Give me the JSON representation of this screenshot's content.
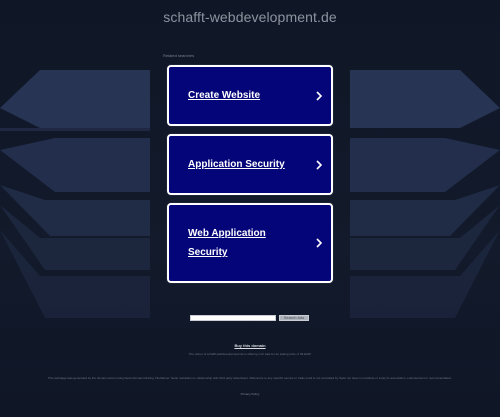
{
  "header": {
    "domain_title": "schafft-webdevelopment.de",
    "related_searches_label": "Related searches"
  },
  "cards": [
    {
      "label": "Create Website"
    },
    {
      "label": "Application Security"
    },
    {
      "label": "Web Application Security"
    }
  ],
  "search": {
    "placeholder": "",
    "button_label": "Search Ads"
  },
  "footer": {
    "buy_link": "Buy this domain",
    "owner_note": "The owner of schafft-webdevelopment.de is offering it for sale for an asking price of 99 EUR!",
    "disclaimer": "This webpage was generated by the domain owner using Sedo Domain Parking. Disclaimer: Sedo maintains no relationship with third party advertisers. Reference to any specific service or trade mark is not controlled by Sedo nor does it constitute or imply its association, endorsement or recommendation.",
    "privacy_link": "Privacy Policy"
  },
  "colors": {
    "background": "#101828",
    "card_fill": "#05057a",
    "card_border": "#ffffff",
    "decor_band": "#2c3a5c"
  },
  "icons": {
    "card_chevron": "chevron-right-icon"
  }
}
